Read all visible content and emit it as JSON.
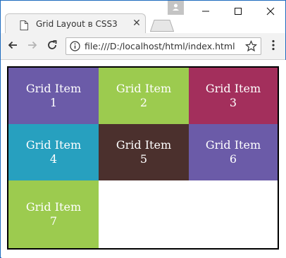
{
  "browser": {
    "tab": {
      "title": "Grid Layout в CSS3",
      "icon": "document-icon",
      "close_glyph": "✕"
    },
    "address": {
      "url": "file:///D:/localhost/html/index.html",
      "info_icon": "info-icon",
      "star_icon": "star-icon"
    },
    "nav": {
      "back_icon": "back-arrow-icon",
      "forward_icon": "forward-arrow-icon",
      "reload_icon": "reload-icon",
      "menu_icon": "kebab-menu-icon"
    },
    "window_controls": {
      "minimize_icon": "minimize-icon",
      "maximize_icon": "maximize-icon",
      "close_icon": "close-icon"
    }
  },
  "grid": {
    "items": [
      {
        "line1": "Grid Item",
        "line2": "1",
        "color": "#6b5ba8"
      },
      {
        "line1": "Grid Item",
        "line2": "2",
        "color": "#9ccb4f"
      },
      {
        "line1": "Grid Item",
        "line2": "3",
        "color": "#a32f5c"
      },
      {
        "line1": "Grid Item",
        "line2": "4",
        "color": "#27a0bf"
      },
      {
        "line1": "Grid Item",
        "line2": "5",
        "color": "#4b302d"
      },
      {
        "line1": "Grid Item",
        "line2": "6",
        "color": "#6b5ba8"
      },
      {
        "line1": "Grid Item",
        "line2": "7",
        "color": "#9ccb4f"
      }
    ]
  }
}
